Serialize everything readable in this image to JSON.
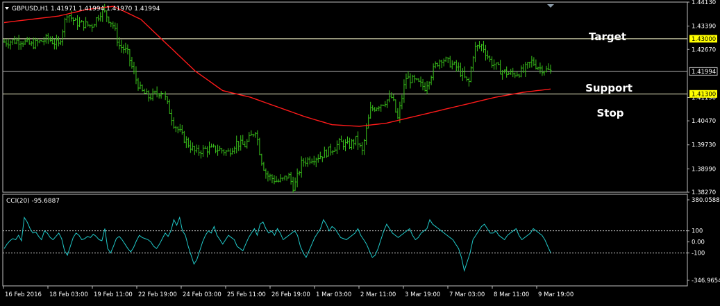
{
  "colors": {
    "background": "#000000",
    "frame": "#c0c0c0",
    "text": "#ffffff",
    "bars": "#39c21b",
    "moving_average": "#ff1a1a",
    "cci_line": "#20c8c8",
    "level_line": "#f2f2c8",
    "level_tag": "#ffff00",
    "current_price_line": "#b8b8b8",
    "dashed": "#d0d0d0"
  },
  "symbol_header": {
    "menu_icon": "triangle-down-icon",
    "text": "GBPUSD,H1  1.41971 1.41994 1.41970 1.41994"
  },
  "annotations": {
    "target": "Target",
    "support": "Support",
    "stop": "Stop"
  },
  "chart_data": [
    {
      "type": "bar",
      "subtype": "ohlc",
      "symbol": "GBPUSD",
      "timeframe": "H1",
      "ohlc_last": {
        "open": "1.41971",
        "high": "1.41994",
        "low": "1.41970",
        "close": "1.41994"
      },
      "ylim": [
        1.3827,
        1.4413
      ],
      "y_ticks": [
        "1.44130",
        "1.43390",
        "1.42670",
        "1.41190",
        "1.40470",
        "1.39730",
        "1.38990",
        "1.38270"
      ],
      "price_tags": [
        {
          "name": "target",
          "value": 1.43,
          "text": "1.43000",
          "highlight": true
        },
        {
          "name": "current",
          "value": 1.41994,
          "text": "1.41994",
          "highlight": false
        },
        {
          "name": "stop",
          "value": 1.413,
          "text": "1.41300",
          "highlight": true
        }
      ],
      "horizontal_levels": [
        {
          "name": "target",
          "value": 1.43
        },
        {
          "name": "current",
          "value": 1.41994
        },
        {
          "name": "stop",
          "value": 1.413
        }
      ],
      "x_labels": [
        "16 Feb 2016",
        "18 Feb 03:00",
        "19 Feb 11:00",
        "22 Feb 19:00",
        "24 Feb 03:00",
        "25 Feb 11:00",
        "26 Feb 19:00",
        "1 Mar 03:00",
        "2 Mar 11:00",
        "3 Mar 19:00",
        "7 Mar 03:00",
        "8 Mar 11:00",
        "9 Mar 19:00"
      ],
      "close_path": [
        [
          0,
          1.429
        ],
        [
          0.03,
          1.4295
        ],
        [
          0.05,
          1.428
        ],
        [
          0.08,
          1.43
        ],
        [
          0.1,
          1.428
        ],
        [
          0.115,
          1.438
        ],
        [
          0.13,
          1.435
        ],
        [
          0.16,
          1.434
        ],
        [
          0.18,
          1.439
        ],
        [
          0.2,
          1.434
        ],
        [
          0.21,
          1.428
        ],
        [
          0.225,
          1.426
        ],
        [
          0.24,
          1.418
        ],
        [
          0.25,
          1.414
        ],
        [
          0.265,
          1.412
        ],
        [
          0.29,
          1.414
        ],
        [
          0.31,
          1.404
        ],
        [
          0.33,
          1.399
        ],
        [
          0.35,
          1.395
        ],
        [
          0.37,
          1.396
        ],
        [
          0.39,
          1.396
        ],
        [
          0.41,
          1.395
        ],
        [
          0.425,
          1.398
        ],
        [
          0.44,
          1.397
        ],
        [
          0.46,
          1.402
        ],
        [
          0.47,
          1.393
        ],
        [
          0.48,
          1.388
        ],
        [
          0.5,
          1.386
        ],
        [
          0.51,
          1.3865
        ],
        [
          0.52,
          1.388
        ],
        [
          0.53,
          1.384
        ],
        [
          0.545,
          1.392
        ],
        [
          0.56,
          1.393
        ],
        [
          0.58,
          1.394
        ],
        [
          0.6,
          1.396
        ],
        [
          0.615,
          1.398
        ],
        [
          0.63,
          1.397
        ],
        [
          0.645,
          1.399
        ],
        [
          0.655,
          1.395
        ],
        [
          0.67,
          1.408
        ],
        [
          0.69,
          1.41
        ],
        [
          0.71,
          1.412
        ],
        [
          0.72,
          1.405
        ],
        [
          0.735,
          1.418
        ],
        [
          0.75,
          1.417
        ],
        [
          0.77,
          1.415
        ],
        [
          0.79,
          1.422
        ],
        [
          0.8,
          1.424
        ],
        [
          0.83,
          1.421
        ],
        [
          0.85,
          1.416
        ],
        [
          0.86,
          1.427
        ],
        [
          0.875,
          1.428
        ],
        [
          0.89,
          1.423
        ],
        [
          0.91,
          1.42
        ],
        [
          0.93,
          1.419
        ],
        [
          0.95,
          1.42
        ],
        [
          0.965,
          1.423
        ],
        [
          0.98,
          1.421
        ],
        [
          1.0,
          1.41994
        ]
      ],
      "moving_average": [
        [
          0,
          1.435
        ],
        [
          0.1,
          1.437
        ],
        [
          0.15,
          1.439
        ],
        [
          0.2,
          1.44
        ],
        [
          0.25,
          1.436
        ],
        [
          0.3,
          1.428
        ],
        [
          0.35,
          1.42
        ],
        [
          0.4,
          1.414
        ],
        [
          0.45,
          1.412
        ],
        [
          0.5,
          1.409
        ],
        [
          0.55,
          1.406
        ],
        [
          0.6,
          1.4035
        ],
        [
          0.65,
          1.403
        ],
        [
          0.7,
          1.404
        ],
        [
          0.75,
          1.406
        ],
        [
          0.8,
          1.408
        ],
        [
          0.85,
          1.41
        ],
        [
          0.9,
          1.412
        ],
        [
          0.95,
          1.4135
        ],
        [
          1.0,
          1.4145
        ]
      ]
    },
    {
      "type": "line",
      "indicator": "CCI",
      "header_text": "CCI(20) -95.6887",
      "period": 20,
      "last_value": -95.6887,
      "ylim": [
        -346.9654,
        380.0588
      ],
      "y_ticks": [
        "380.0588",
        "100",
        "0.00",
        "-100",
        "-346.9654"
      ],
      "dashed_levels": [
        100,
        -100
      ],
      "values": [
        -60,
        -20,
        10,
        30,
        20,
        60,
        10,
        220,
        180,
        120,
        80,
        90,
        50,
        20,
        100,
        80,
        40,
        20,
        50,
        80,
        30,
        -80,
        -120,
        -40,
        40,
        80,
        60,
        20,
        30,
        50,
        40,
        70,
        50,
        20,
        10,
        120,
        -60,
        -100,
        -40,
        30,
        50,
        20,
        -20,
        -60,
        -90,
        -50,
        10,
        60,
        40,
        30,
        20,
        0,
        -40,
        -60,
        -20,
        30,
        80,
        50,
        100,
        200,
        150,
        220,
        100,
        60,
        -40,
        -120,
        -200,
        -160,
        -80,
        0,
        60,
        100,
        80,
        140,
        60,
        20,
        -20,
        20,
        60,
        40,
        20,
        -40,
        -60,
        -80,
        -20,
        40,
        80,
        120,
        60,
        160,
        180,
        120,
        80,
        100,
        60,
        120,
        80,
        20,
        40,
        60,
        80,
        100,
        60,
        -40,
        -100,
        -140,
        -80,
        -20,
        40,
        80,
        120,
        200,
        160,
        100,
        140,
        120,
        80,
        40,
        30,
        20,
        40,
        60,
        80,
        120,
        60,
        20,
        -20,
        -80,
        -140,
        -120,
        -60,
        20,
        100,
        160,
        120,
        80,
        60,
        40,
        60,
        80,
        100,
        120,
        60,
        20,
        40,
        80,
        100,
        120,
        200,
        160,
        140,
        120,
        100,
        80,
        60,
        40,
        20,
        -20,
        -60,
        -140,
        -260,
        -180,
        -100,
        20,
        60,
        100,
        140,
        160,
        120,
        80,
        80,
        100,
        60,
        40,
        20,
        60,
        80,
        100,
        120,
        60,
        20,
        40,
        60,
        80,
        120,
        100,
        80,
        60,
        20,
        -40,
        -96
      ]
    }
  ]
}
